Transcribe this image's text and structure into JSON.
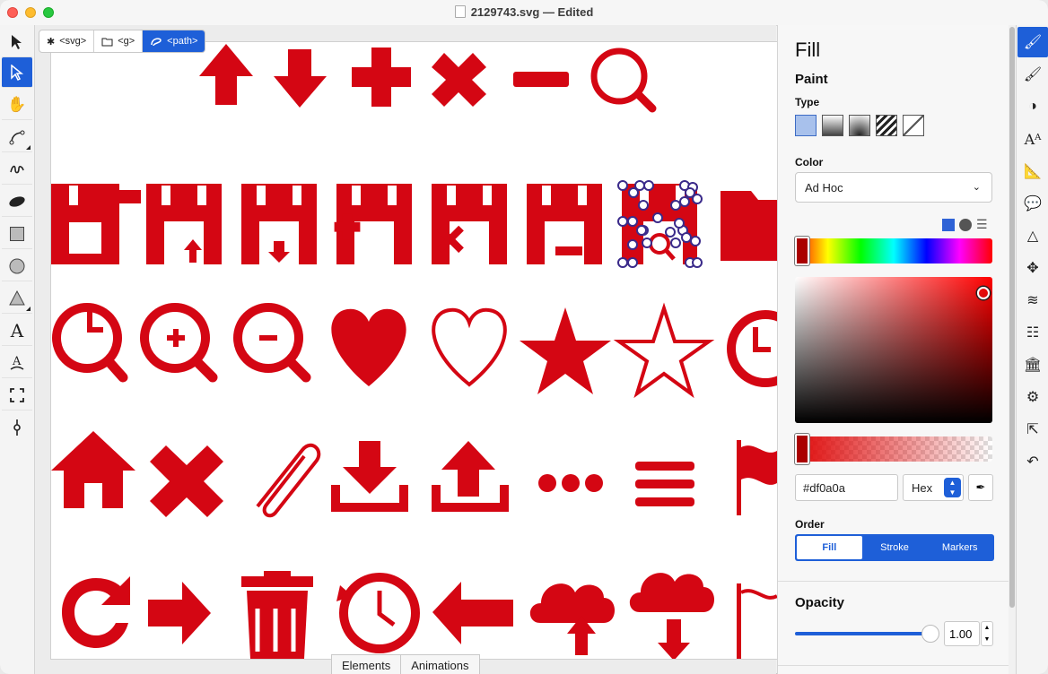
{
  "window": {
    "title": "2129743.svg — Edited"
  },
  "breadcrumb": [
    {
      "label": "<svg>",
      "icon": "asterisk-icon"
    },
    {
      "label": "<g>",
      "icon": "folder-icon"
    },
    {
      "label": "<path>",
      "icon": "path-icon"
    }
  ],
  "bottom_tabs": [
    "Elements",
    "Animations"
  ],
  "left_tools": [
    "selection-arrow",
    "node-select",
    "hand",
    "pen",
    "freehand",
    "ellipse-fill",
    "rectangle",
    "circle",
    "polygon",
    "text",
    "text-on-path",
    "bounds",
    "anchor"
  ],
  "right_tools": [
    "fill",
    "brush",
    "contrast",
    "typography",
    "ruler",
    "comment",
    "triangle",
    "move",
    "layers",
    "list",
    "library",
    "settings",
    "export",
    "undo"
  ],
  "fill_panel": {
    "title": "Fill",
    "paint_heading": "Paint",
    "type_label": "Type",
    "color_label": "Color",
    "color_mode": "Ad Hoc",
    "hex_value": "#df0a0a",
    "hex_format": "Hex",
    "order_label": "Order",
    "order_options": [
      "Fill",
      "Stroke",
      "Markers"
    ],
    "order_selected": "Fill",
    "opacity_heading": "Opacity",
    "opacity_value": "1.00",
    "accent_color": "#1e5fd8",
    "fill_color": "#df0a0a"
  }
}
